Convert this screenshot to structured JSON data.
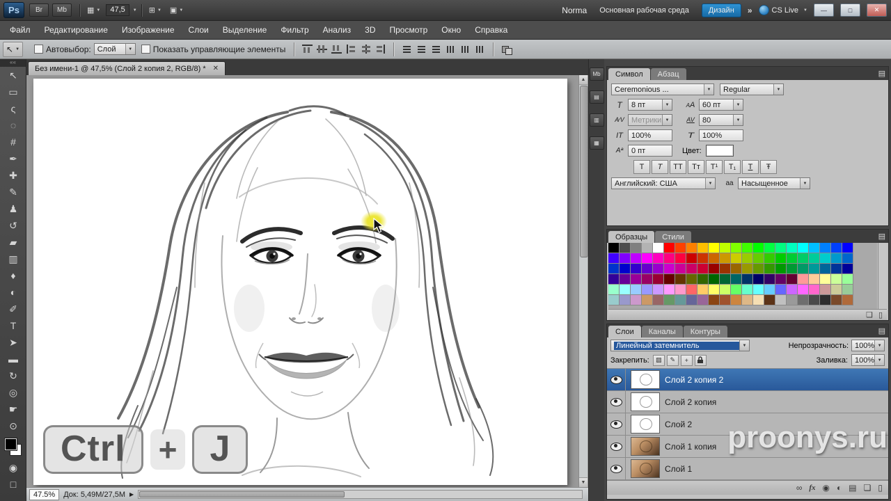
{
  "titlebar": {
    "logo": "Ps",
    "bridge_label": "Br",
    "minibridge_label": "Mb",
    "zoom_level": "47,5",
    "view_extras_glyph": "▦",
    "arrange_glyph": "⊞",
    "screen_mode_glyph": "▣",
    "screen_hint": "Norma",
    "workspace_main": "Основная рабочая среда",
    "workspace_active": "Дизайн",
    "overflow_glyph": "»",
    "cs_live_label": "CS Live",
    "win_min_glyph": "—",
    "win_max_glyph": "□",
    "win_close_glyph": "✕"
  },
  "menu": {
    "items": [
      "Файл",
      "Редактирование",
      "Изображение",
      "Слои",
      "Выделение",
      "Фильтр",
      "Анализ",
      "3D",
      "Просмотр",
      "Окно",
      "Справка"
    ]
  },
  "options": {
    "tool_glyph": "↖",
    "autoselect_label": "Автовыбор:",
    "autoselect_value": "Слой",
    "show_controls_label": "Показать управляющие элементы"
  },
  "tools": [
    {
      "name": "move-tool",
      "glyph": "↖"
    },
    {
      "name": "rectangular-marquee-tool",
      "glyph": "▭"
    },
    {
      "name": "lasso-tool",
      "glyph": "ς"
    },
    {
      "name": "quick-selection-tool",
      "glyph": "◌"
    },
    {
      "name": "crop-tool",
      "glyph": "#"
    },
    {
      "name": "eyedropper-tool",
      "glyph": "✒"
    },
    {
      "name": "healing-brush-tool",
      "glyph": "✚"
    },
    {
      "name": "brush-tool",
      "glyph": "✎"
    },
    {
      "name": "clone-stamp-tool",
      "glyph": "♟"
    },
    {
      "name": "history-brush-tool",
      "glyph": "↺"
    },
    {
      "name": "eraser-tool",
      "glyph": "▰"
    },
    {
      "name": "gradient-tool",
      "glyph": "▥"
    },
    {
      "name": "blur-tool",
      "glyph": "♦"
    },
    {
      "name": "dodge-tool",
      "glyph": "◐"
    },
    {
      "name": "pen-tool",
      "glyph": "✐"
    },
    {
      "name": "type-tool",
      "glyph": "T"
    },
    {
      "name": "path-selection-tool",
      "glyph": "➤"
    },
    {
      "name": "shape-tool",
      "glyph": "▬"
    },
    {
      "name": "rotate-view-tool",
      "glyph": "↻"
    },
    {
      "name": "3d-camera-tool",
      "glyph": "◎"
    },
    {
      "name": "hand-tool",
      "glyph": "☛"
    },
    {
      "name": "zoom-tool",
      "glyph": "⊙"
    }
  ],
  "extra_tools": [
    {
      "name": "quick-mask-button",
      "glyph": "◉"
    },
    {
      "name": "screen-mode-toggle-button",
      "glyph": "□"
    }
  ],
  "dock_buttons": [
    {
      "name": "minibridge-dock-button",
      "glyph": "Mb"
    },
    {
      "name": "dock-panel-button-1",
      "glyph": "▤"
    },
    {
      "name": "dock-panel-button-2",
      "glyph": "▥"
    },
    {
      "name": "dock-panel-button-3",
      "glyph": "▦"
    }
  ],
  "document": {
    "tab_title": "Без имени-1 @ 47,5% (Слой 2 копия 2, RGB/8) *",
    "close_glyph": "✕",
    "overlay_keys": [
      "Ctrl",
      "+",
      "J"
    ]
  },
  "statusbar": {
    "zoom": "47.5%",
    "doc_info": "Док: 5,49M/27,5M",
    "popup_glyph": "▶"
  },
  "character_panel": {
    "tabs": [
      "Символ",
      "Абзац"
    ],
    "font_family": "Ceremonious ...",
    "font_style": "Regular",
    "font_size": "8 пт",
    "leading": "60 пт",
    "kerning": "Метрики",
    "tracking": "80",
    "vertical_scale": "100%",
    "horizontal_scale": "100%",
    "baseline_shift": "0 пт",
    "color_label": "Цвет:",
    "style_buttons": [
      {
        "name": "faux-bold-button",
        "glyph": "T"
      },
      {
        "name": "faux-italic-button",
        "glyph": "T"
      },
      {
        "name": "all-caps-button",
        "glyph": "TT"
      },
      {
        "name": "small-caps-button",
        "glyph": "Tт"
      },
      {
        "name": "superscript-button",
        "glyph": "T¹"
      },
      {
        "name": "subscript-button",
        "glyph": "T₁"
      },
      {
        "name": "underline-button",
        "glyph": "T"
      },
      {
        "name": "strikethrough-button",
        "glyph": "Ŧ"
      }
    ],
    "language": "Английский: США",
    "anti_alias": "Насыщенное"
  },
  "swatches_panel": {
    "tabs": [
      "Образцы",
      "Стили"
    ],
    "palette": [
      [
        "#000000",
        "#4d4d4d",
        "#808080",
        "#b3b3b3",
        "#ffffff",
        "#ff0000",
        "#ff4000",
        "#ff8000",
        "#ffbf00",
        "#ffff00",
        "#bfff00",
        "#80ff00",
        "#40ff00",
        "#00ff00",
        "#00ff40",
        "#00ff80",
        "#00ffbf",
        "#00ffff",
        "#00bfff",
        "#0080ff",
        "#0040ff",
        "#0000ff"
      ],
      [
        "#4000ff",
        "#8000ff",
        "#bf00ff",
        "#ff00ff",
        "#ff00bf",
        "#ff0080",
        "#ff0040",
        "#cc0000",
        "#cc3300",
        "#cc6600",
        "#cc9900",
        "#cccc00",
        "#99cc00",
        "#66cc00",
        "#33cc00",
        "#00cc00",
        "#00cc33",
        "#00cc66",
        "#00cc99",
        "#00cccc",
        "#0099cc",
        "#0066cc"
      ],
      [
        "#0033cc",
        "#0000cc",
        "#3300cc",
        "#6600cc",
        "#9900cc",
        "#cc00cc",
        "#cc0099",
        "#cc0066",
        "#cc0033",
        "#990000",
        "#993300",
        "#996600",
        "#999900",
        "#669900",
        "#339900",
        "#009900",
        "#009933",
        "#009966",
        "#009999",
        "#006699",
        "#003399",
        "#000099"
      ],
      [
        "#330099",
        "#660099",
        "#990099",
        "#990066",
        "#990033",
        "#660000",
        "#663300",
        "#666600",
        "#336600",
        "#006600",
        "#006633",
        "#006666",
        "#003366",
        "#000066",
        "#330066",
        "#660066",
        "#660033",
        "#ff9999",
        "#ffcc99",
        "#ffff99",
        "#ccff99",
        "#99ff99"
      ],
      [
        "#99ffcc",
        "#99ffff",
        "#99ccff",
        "#9999ff",
        "#cc99ff",
        "#ff99ff",
        "#ff99cc",
        "#ff6666",
        "#ffcc66",
        "#ffff66",
        "#ccff66",
        "#66ff66",
        "#66ffcc",
        "#66ffff",
        "#66ccff",
        "#6666ff",
        "#cc66ff",
        "#ff66ff",
        "#ff66cc",
        "#cc9999",
        "#cccc99",
        "#99cc99"
      ],
      [
        "#99cccc",
        "#9999cc",
        "#cc99cc",
        "#cc9966",
        "#996666",
        "#669966",
        "#669999",
        "#666699",
        "#996699",
        "#8b4513",
        "#a0522d",
        "#cd853f",
        "#deb887",
        "#f5deb3",
        "#5c3317",
        "#c0c0c0",
        "#9a9a9a",
        "#6e6e6e",
        "#4a4a4a",
        "#2e2e2e",
        "#7a4a2a",
        "#b06a3a"
      ]
    ]
  },
  "layers_panel": {
    "tabs": [
      "Слои",
      "Каналы",
      "Контуры"
    ],
    "blend_mode": "Линейный затемнитель",
    "opacity_label": "Непрозрачность:",
    "opacity_value": "100%",
    "lock_label": "Закрепить:",
    "fill_label": "Заливка:",
    "fill_value": "100%",
    "lock_icons": [
      {
        "name": "lock-transparency-icon",
        "glyph": "▨"
      },
      {
        "name": "lock-pixels-icon",
        "glyph": "✎"
      },
      {
        "name": "lock-position-icon",
        "glyph": "+"
      },
      {
        "name": "lock-all-icon",
        "glyph": "lock-svg"
      }
    ],
    "layers": [
      {
        "name": "Слой 2 копия 2",
        "selected": true,
        "thumb": "sketch"
      },
      {
        "name": "Слой 2 копия",
        "selected": false,
        "thumb": "sketch"
      },
      {
        "name": "Слой 2",
        "selected": false,
        "thumb": "sketch"
      },
      {
        "name": "Слой 1 копия",
        "selected": false,
        "thumb": "photo"
      },
      {
        "name": "Слой 1",
        "selected": false,
        "thumb": "photo"
      }
    ],
    "bottom_icons": [
      {
        "name": "link-layers-icon",
        "glyph": "∞"
      },
      {
        "name": "layer-style-icon",
        "glyph": "fx"
      },
      {
        "name": "layer-mask-icon",
        "glyph": "◉"
      },
      {
        "name": "adjustment-layer-icon",
        "glyph": "◐"
      },
      {
        "name": "layer-group-icon",
        "glyph": "▤"
      },
      {
        "name": "new-layer-icon",
        "glyph": "❏"
      },
      {
        "name": "delete-layer-icon",
        "glyph": "▯"
      }
    ]
  },
  "watermark": "proonys.ru",
  "colors": {
    "selection_blue": "#29599a",
    "workspace_accent": "#1d82c4",
    "highlight_yellow": "#e8e337"
  }
}
